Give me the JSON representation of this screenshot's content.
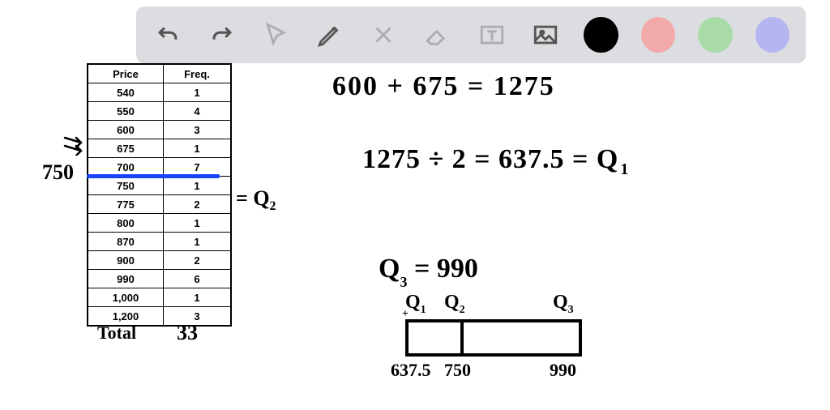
{
  "toolbar": {
    "tools": [
      "undo",
      "redo",
      "pointer",
      "pencil",
      "tools",
      "eraser",
      "textbox",
      "image"
    ],
    "swatches": [
      "#000000",
      "#f2a9a9",
      "#a9dba9",
      "#b5b5f2"
    ]
  },
  "table": {
    "headers": [
      "Price",
      "Freq."
    ],
    "rows": [
      [
        "540",
        "1"
      ],
      [
        "550",
        "4"
      ],
      [
        "600",
        "3"
      ],
      [
        "675",
        "1"
      ],
      [
        "700",
        "7"
      ],
      [
        "750",
        "1"
      ],
      [
        "775",
        "2"
      ],
      [
        "800",
        "1"
      ],
      [
        "870",
        "1"
      ],
      [
        "900",
        "2"
      ],
      [
        "990",
        "6"
      ],
      [
        "1,000",
        "1"
      ],
      [
        "1,200",
        "3"
      ]
    ],
    "total_label": "Total",
    "total_value": "33"
  },
  "annotations": {
    "arrow_750": "750",
    "eq_q2": "= Q",
    "eq_q2_sub": "2",
    "line1": "600 + 675 = 1275",
    "line2": "1275 ÷ 2 = 637.5 = Q",
    "line2_sub": "1",
    "q3": "Q  = 990",
    "q3_sub": "3",
    "bp_q1": "Q",
    "bp_q1_sub": "1",
    "bp_q2": "Q",
    "bp_q2_sub": "2",
    "bp_q3": "Q",
    "bp_q3_sub": "3",
    "bp_v1": "637.5",
    "bp_v2": "750",
    "bp_v3": "990"
  },
  "chart_data": {
    "type": "table",
    "title": "Frequency table with quartile computation",
    "columns": [
      "Price",
      "Freq."
    ],
    "rows": [
      [
        540,
        1
      ],
      [
        550,
        4
      ],
      [
        600,
        3
      ],
      [
        675,
        1
      ],
      [
        700,
        7
      ],
      [
        750,
        1
      ],
      [
        775,
        2
      ],
      [
        800,
        1
      ],
      [
        870,
        1
      ],
      [
        900,
        2
      ],
      [
        990,
        6
      ],
      [
        1000,
        1
      ],
      [
        1200,
        3
      ]
    ],
    "total_frequency": 33,
    "quartiles": {
      "Q1": 637.5,
      "Q2": 750,
      "Q3": 990
    },
    "boxplot": {
      "Q1": 637.5,
      "Q2": 750,
      "Q3": 990
    }
  }
}
